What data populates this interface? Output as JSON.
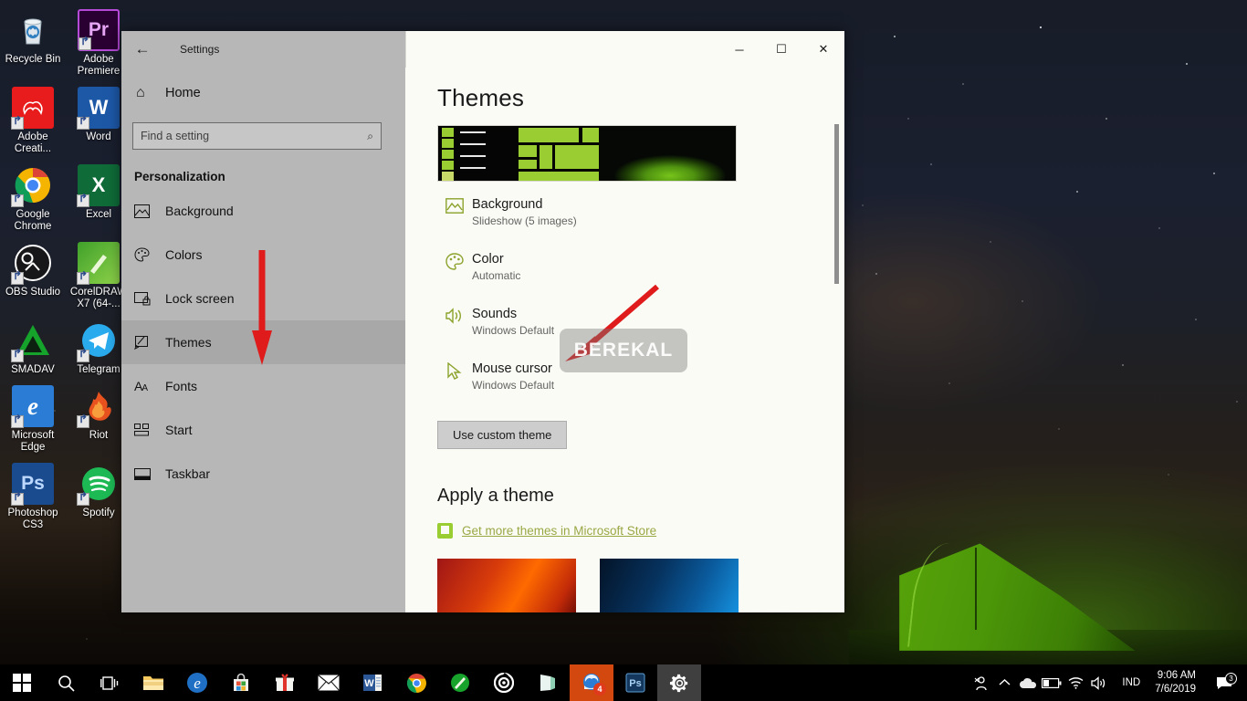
{
  "desktop": {
    "icons": [
      {
        "label": "Recycle Bin",
        "icon": "recycle-bin-icon",
        "shortcut": false
      },
      {
        "label": "Adobe Premiere",
        "icon": "adobe-premiere-icon",
        "shortcut": true
      },
      {
        "label": "Adobe Creati...",
        "icon": "adobe-creative-cloud-icon",
        "shortcut": true
      },
      {
        "label": "Word",
        "icon": "microsoft-word-icon",
        "shortcut": true
      },
      {
        "label": "Google Chrome",
        "icon": "google-chrome-icon",
        "shortcut": true
      },
      {
        "label": "Excel",
        "icon": "microsoft-excel-icon",
        "shortcut": true
      },
      {
        "label": "OBS Studio",
        "icon": "obs-studio-icon",
        "shortcut": true
      },
      {
        "label": "CorelDRAW X7 (64-...",
        "icon": "coreldraw-icon",
        "shortcut": true
      },
      {
        "label": "SMADAV",
        "icon": "smadav-icon",
        "shortcut": true
      },
      {
        "label": "Telegram",
        "icon": "telegram-icon",
        "shortcut": true
      },
      {
        "label": "Microsoft Edge",
        "icon": "microsoft-edge-icon",
        "shortcut": true
      },
      {
        "label": "Riot",
        "icon": "riot-icon",
        "shortcut": true
      },
      {
        "label": "Photoshop CS3",
        "icon": "photoshop-icon",
        "shortcut": true
      },
      {
        "label": "Spotify",
        "icon": "spotify-icon",
        "shortcut": true
      }
    ]
  },
  "window": {
    "title": "Settings",
    "back_icon": "back-arrow-icon",
    "minimize_glyph": "─",
    "maximize_glyph": "☐",
    "close_glyph": "✕"
  },
  "nav": {
    "home_label": "Home",
    "home_icon": "home-icon",
    "search": {
      "placeholder": "Find a setting",
      "value": "",
      "icon": "search-icon"
    },
    "section_title": "Personalization",
    "items": [
      {
        "label": "Background",
        "icon": "background-image-icon",
        "active": false
      },
      {
        "label": "Colors",
        "icon": "color-palette-icon",
        "active": false
      },
      {
        "label": "Lock screen",
        "icon": "lock-screen-icon",
        "active": false
      },
      {
        "label": "Themes",
        "icon": "themes-brush-icon",
        "active": true
      },
      {
        "label": "Fonts",
        "icon": "fonts-icon",
        "active": false
      },
      {
        "label": "Start",
        "icon": "start-tiles-icon",
        "active": false
      },
      {
        "label": "Taskbar",
        "icon": "taskbar-icon",
        "active": false
      }
    ]
  },
  "content": {
    "page_title": "Themes",
    "preview_name": "current-theme-preview",
    "settings": [
      {
        "name": "Background",
        "value": "Slideshow (5 images)",
        "icon": "background-image-icon"
      },
      {
        "name": "Color",
        "value": "Automatic",
        "icon": "color-palette-icon"
      },
      {
        "name": "Sounds",
        "value": "Windows Default",
        "icon": "sound-speaker-icon"
      },
      {
        "name": "Mouse cursor",
        "value": "Windows Default",
        "icon": "mouse-cursor-icon"
      }
    ],
    "custom_theme_button": "Use custom theme",
    "apply_section_title": "Apply a theme",
    "store_link": "Get more themes in Microsoft Store",
    "store_link_icon": "microsoft-store-icon",
    "theme_thumbnails": [
      {
        "name": "canyon-theme-thumbnail"
      },
      {
        "name": "blue-theme-thumbnail"
      }
    ],
    "accent_color": "#9acd32",
    "link_color": "#9aa844"
  },
  "annotations": {
    "arrow_color": "#e01b1b",
    "watermark_text": "BEREKAL"
  },
  "taskbar": {
    "items": [
      {
        "name": "start-button",
        "icon": "windows-logo-icon",
        "state": "normal",
        "badge": ""
      },
      {
        "name": "search-button",
        "icon": "search-icon",
        "state": "normal",
        "badge": ""
      },
      {
        "name": "task-view-button",
        "icon": "task-view-icon",
        "state": "normal",
        "badge": ""
      },
      {
        "name": "file-explorer-button",
        "icon": "folder-icon",
        "state": "normal",
        "badge": ""
      },
      {
        "name": "edge-button",
        "icon": "microsoft-edge-icon",
        "state": "normal",
        "badge": ""
      },
      {
        "name": "store-button",
        "icon": "microsoft-store-icon",
        "state": "normal",
        "badge": ""
      },
      {
        "name": "gift-button",
        "icon": "gift-box-icon",
        "state": "normal",
        "badge": ""
      },
      {
        "name": "mail-button",
        "icon": "mail-envelope-icon",
        "state": "normal",
        "badge": ""
      },
      {
        "name": "word-button",
        "icon": "microsoft-word-icon",
        "state": "normal",
        "badge": ""
      },
      {
        "name": "chrome-button",
        "icon": "google-chrome-icon",
        "state": "normal",
        "badge": ""
      },
      {
        "name": "smadav-button",
        "icon": "smadav-icon",
        "state": "normal",
        "badge": ""
      },
      {
        "name": "spiral-app-button",
        "icon": "spiral-target-icon",
        "state": "normal",
        "badge": ""
      },
      {
        "name": "onenote-button",
        "icon": "onenote-icon",
        "state": "normal",
        "badge": ""
      },
      {
        "name": "messenger-button",
        "icon": "messenger-icon",
        "state": "active-orange",
        "badge": "4"
      },
      {
        "name": "photoshop-button",
        "icon": "photoshop-icon",
        "state": "normal",
        "badge": ""
      },
      {
        "name": "settings-button",
        "icon": "gear-icon",
        "state": "active-gray",
        "badge": ""
      }
    ],
    "tray": {
      "icons": [
        {
          "name": "people-icon",
          "glyph": "⚯"
        },
        {
          "name": "show-hidden-icons-chevron",
          "glyph": "∧"
        },
        {
          "name": "onedrive-cloud-icon",
          "glyph": "☁"
        },
        {
          "name": "battery-icon",
          "glyph": "▭"
        },
        {
          "name": "wifi-icon",
          "glyph": "◠"
        },
        {
          "name": "volume-icon",
          "glyph": "🔊"
        }
      ],
      "language": "IND",
      "time": "9:06 AM",
      "date": "7/6/2019",
      "notification_icon": "notification-icon",
      "notification_count": "3"
    }
  }
}
